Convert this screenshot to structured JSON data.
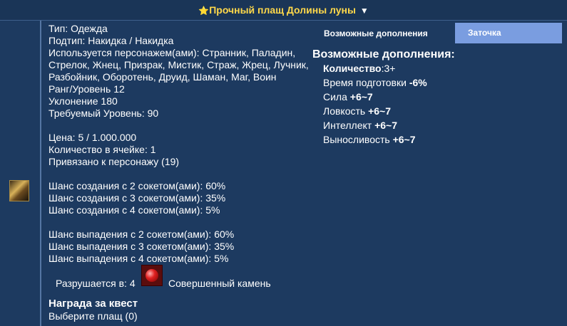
{
  "header": {
    "star": "⭐",
    "title": "Прочный плащ Долины луны",
    "arrow": "▼"
  },
  "item": {
    "icon": "cloak-item-icon",
    "lines": {
      "type": "Тип: Одежда",
      "subtype": "Подтип: Накидка / Накидка",
      "used_by_1": "Используется персонажем(ами): Странник, Паладин,",
      "used_by_2": "Стрелок, Жнец, Призрак, Мистик, Страж, Жрец, Лучник,",
      "used_by_3": "Разбойник, Оборотень, Друид, Шаман, Маг, Воин",
      "rank": "Ранг/Уровень 12",
      "evasion": "Уклонение 180",
      "req_level": "Требуемый Уровень: 90",
      "price": "Цена: 5 / 1.000.000",
      "stack": "Количество в ячейке: 1",
      "bound": "Привязано к персонажу (19)",
      "craft2": "Шанс создания с 2 сокетом(ами): 60%",
      "craft3": "Шанс создания с 3 сокетом(ами): 35%",
      "craft4": "Шанс создания с 4 сокетом(ами): 5%",
      "drop2": "Шанс выпадения с 2 сокетом(ами): 60%",
      "drop3": "Шанс выпадения с 3 сокетом(ами): 35%",
      "drop4": "Шанс выпадения с 4 сокетом(ами): 5%"
    },
    "destroy_label": "Разрушается в: 4",
    "gem_icon": "red-gem-icon",
    "gem_name": "Совершенный камень",
    "quest_title": "Награда за квест",
    "quest_sub": "Выберите плащ (0)"
  },
  "tabs": {
    "upgrades": "Возможные дополнения",
    "sharpen": "Заточка",
    "active_color": "#7a9de0"
  },
  "upgrades": {
    "title": "Возможные дополнения:",
    "count_label": "Количество",
    "count_value": ":3+",
    "prep_label": "Время подготовки ",
    "prep_value": "-6%",
    "str_label": "Сила ",
    "str_value": "+6~7",
    "agi_label": "Ловкость ",
    "agi_value": "+6~7",
    "int_label": "Интеллект ",
    "int_value": "+6~7",
    "sta_label": "Выносливость ",
    "sta_value": "+6~7"
  }
}
